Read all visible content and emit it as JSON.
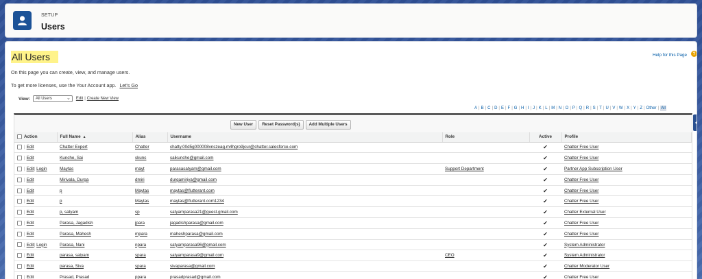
{
  "header": {
    "setup_label": "SETUP",
    "title": "Users"
  },
  "page": {
    "heading": "All Users",
    "help_link": "Help for this Page",
    "help_icon": "?",
    "description": "On this page you can create, view, and manage users.",
    "license_text": "To get more licenses, use the Your Account app.",
    "lets_go": "Let's Go",
    "view_label": "View:",
    "view_selected": "All Users",
    "edit_link": "Edit",
    "create_view_link": "Create New View"
  },
  "alphabet": [
    "A",
    "B",
    "C",
    "D",
    "E",
    "F",
    "G",
    "H",
    "I",
    "J",
    "K",
    "L",
    "M",
    "N",
    "O",
    "P",
    "Q",
    "R",
    "S",
    "T",
    "U",
    "V",
    "W",
    "X",
    "Y",
    "Z",
    "Other",
    "All"
  ],
  "buttons": {
    "new_user": "New User",
    "reset_password": "Reset Password(s)",
    "add_multiple": "Add Multiple Users"
  },
  "columns": {
    "action": "Action",
    "full_name": "Full Name",
    "sort_indicator": "▲",
    "alias": "Alias",
    "username": "Username",
    "role": "Role",
    "active": "Active",
    "profile": "Profile"
  },
  "action_labels": {
    "edit": "Edit",
    "login": "Login"
  },
  "rows": [
    {
      "login": false,
      "name": "Chatter Expert",
      "alias": "Chatter",
      "username": "chatty.00d5g000008vnszeag.m4hgro9jcur@chatter.salesforce.com",
      "role": "",
      "active": "✔",
      "profile": "Chatter Free User"
    },
    {
      "login": false,
      "name": "Kunche, Sai",
      "alias": "skunc",
      "username": "saikunche@gmail.com",
      "role": "",
      "active": "✔",
      "profile": "Chatter Free User"
    },
    {
      "login": true,
      "name": "Maytas",
      "alias": "mayt",
      "username": "parasasatyam@gmail.com",
      "role": "Support Department",
      "active": "✔",
      "profile": "Partner App Subscription User"
    },
    {
      "login": false,
      "name": "Mirivala, Durga",
      "alias": "dmiri",
      "username": "durgamiriya@gmail.com",
      "role": "",
      "active": "✔",
      "profile": "Chatter Free User"
    },
    {
      "login": false,
      "name": "p",
      "alias": "Maytas",
      "username": "maytas@flutterant.com",
      "role": "",
      "active": "✔",
      "profile": "Chatter Free User"
    },
    {
      "login": false,
      "name": "p",
      "alias": "Maytas",
      "username": "maytas@flutterant.com1234",
      "role": "",
      "active": "✔",
      "profile": "Chatter Free User"
    },
    {
      "login": false,
      "name": "p, satyam",
      "alias": "sp",
      "username": "satyamparasa21@guest.gmail.com",
      "role": "",
      "active": "✔",
      "profile": "Chatter External User"
    },
    {
      "login": false,
      "name": "Parasa, Jagadish",
      "alias": "jpara",
      "username": "jagadishparasa@gmail.com",
      "role": "",
      "active": "✔",
      "profile": "Chatter Free User"
    },
    {
      "login": false,
      "name": "Parasa, Mahesh",
      "alias": "mpara",
      "username": "maheshparasa@gmail.com",
      "role": "",
      "active": "✔",
      "profile": "Chatter Free User"
    },
    {
      "login": true,
      "name": "Parasa, Nani",
      "alias": "npara",
      "username": "satyamparasa96@gmail.com",
      "role": "",
      "active": "✔",
      "profile": "System Administrator"
    },
    {
      "login": false,
      "name": "parasa, satyam",
      "alias": "spara",
      "username": "satyamparasa9@gmail.com",
      "role": "CEO",
      "active": "✔",
      "profile": "System Administrator"
    },
    {
      "login": false,
      "name": "parasa, Siva",
      "alias": "spara",
      "username": "sivaparasa@gmail.com",
      "role": "",
      "active": "✔",
      "profile": "Chatter Moderator User"
    },
    {
      "login": false,
      "name": "Prasad, Prasad",
      "alias": "ppara",
      "username": "prasadprasad@gmail.com",
      "role": "",
      "active": "✔",
      "profile": "Chatter Free User"
    }
  ]
}
